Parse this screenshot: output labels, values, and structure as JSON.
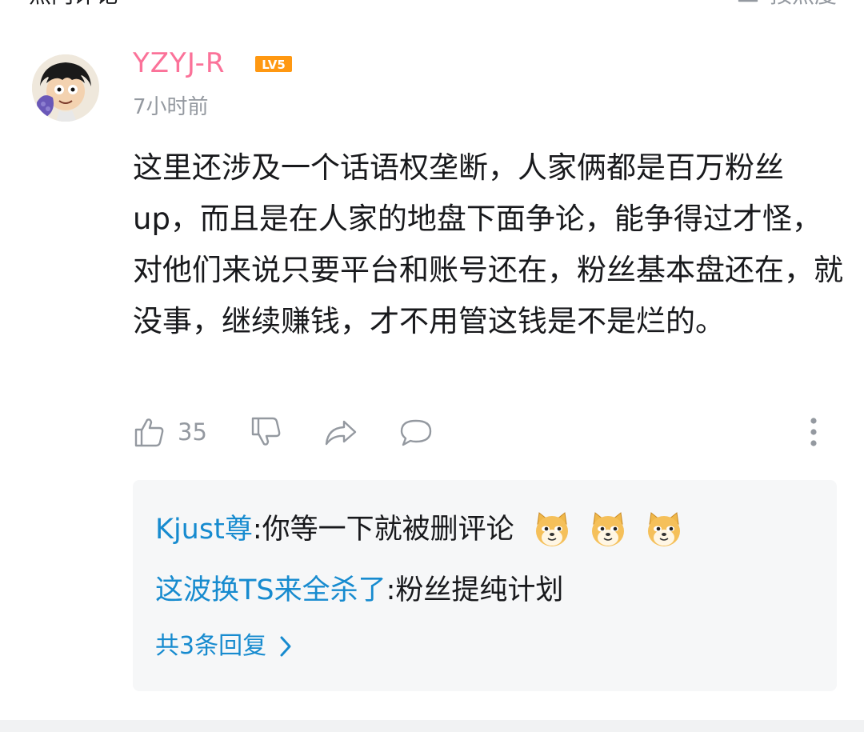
{
  "header": {
    "title": "热门评论",
    "sort_label": "按热度"
  },
  "comment": {
    "username": "YZYJ-R",
    "level": "LV5",
    "time": "7小时前",
    "text": "这里还涉及一个话语权垄断，人家俩都是百万粉丝up，而且是在人家的地盘下面争论，能争得过才怪，对他们来说只要平台和账号还在，粉丝基本盘还在，就没事，继续赚钱，才不用管这钱是不是烂的。",
    "likes": "35"
  },
  "replies": [
    {
      "author": "Kjust尊",
      "sep": ": ",
      "text": "你等一下就被删评论",
      "emojis": [
        "doge-emoji",
        "doge-emoji",
        "doge-emoji"
      ]
    },
    {
      "author": "这波换TS来全杀了",
      "sep": ": ",
      "text": "粉丝提纯计划"
    }
  ],
  "more_replies_label": "共3条回复",
  "colors": {
    "username": "#fb7299",
    "reply_link": "#178bcf",
    "muted": "#9499a0",
    "reply_bg": "#f6f7f8",
    "level_badge": "#ff9811"
  },
  "icons": [
    "sort-icon",
    "thumbs-up-icon",
    "thumbs-down-icon",
    "share-icon",
    "reply-bubble-icon",
    "more-vertical-icon",
    "chevron-right-icon"
  ]
}
